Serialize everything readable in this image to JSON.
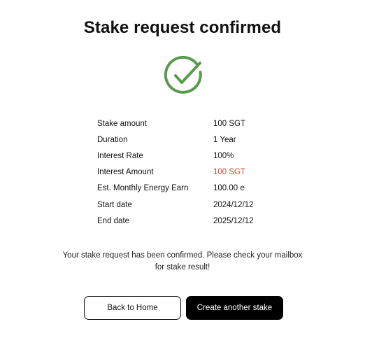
{
  "title": "Stake request confirmed",
  "colors": {
    "success": "#5a9a4e",
    "highlight": "#e0402e",
    "primary_button": "#000000"
  },
  "status_icon": "check-circle-icon",
  "details": [
    {
      "label": "Stake amount",
      "value": "100 SGT",
      "highlight": false
    },
    {
      "label": "Duration",
      "value": "1 Year",
      "highlight": false
    },
    {
      "label": "Interest Rate",
      "value": "100%",
      "highlight": false
    },
    {
      "label": "Interest Amount",
      "value": "100 SGT",
      "highlight": true
    },
    {
      "label": "Est. Monthly Energy Earn",
      "value": "100.00 e",
      "highlight": false
    },
    {
      "label": "Start date",
      "value": "2024/12/12",
      "highlight": false
    },
    {
      "label": "End date",
      "value": "2025/12/12",
      "highlight": false
    }
  ],
  "message_line1": "Your stake request has been confirmed. Please check your mailbox",
  "message_line2": "for stake result!",
  "buttons": {
    "back_home": "Back to Home",
    "create_another": "Create another stake"
  }
}
